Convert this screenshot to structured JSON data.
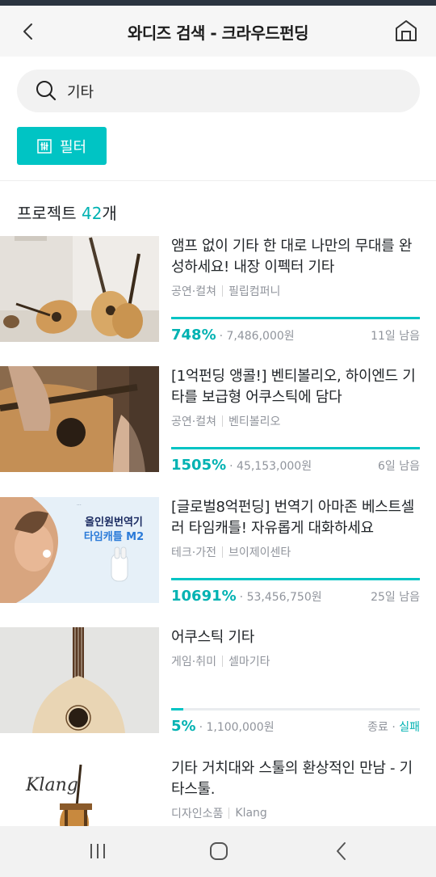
{
  "header": {
    "title": "와디즈 검색 - 크라우드펀딩"
  },
  "search": {
    "query": "기타"
  },
  "filter": {
    "label": "필터"
  },
  "results": {
    "prefix": "프로젝트 ",
    "count": "42",
    "suffix": "개"
  },
  "colors": {
    "accent": "#00c4c4",
    "accent_text": "#00b2b2",
    "meta_text": "#90949c",
    "header_bg": "#f6f6f6"
  },
  "projects": [
    {
      "title": "앰프 없이 기타 한 대로 나만의 무대를 완성하세요! 내장 이펙터 기타",
      "category": "공연·컬쳐",
      "maker": "필립컴퍼니",
      "percent": "748%",
      "amount": "· 7,486,000원",
      "remaining": "11일 남음",
      "progress": 1.0,
      "image": "acoustic-guitars-photo"
    },
    {
      "title": "[1억펀딩 앵콜!] 벤티볼리오, 하이엔드 기타를 보급형 어쿠스틱에 담다",
      "category": "공연·컬쳐",
      "maker": "벤티볼리오",
      "percent": "1505%",
      "amount": "· 45,153,000원",
      "remaining": "6일 남음",
      "progress": 1.0,
      "image": "guitar-playing-photo"
    },
    {
      "title": "[글로벌8억펀딩] 번역기 아마존 베스트셀러 타임캐틀! 자유롭게 대화하세요",
      "category": "테크·가전",
      "maker": "브이제이센타",
      "percent": "10691%",
      "amount": "· 53,456,750원",
      "remaining": "25일 남음",
      "progress": 1.0,
      "image": "translator-earbuds-photo",
      "banner_line1": "올인원번역기",
      "banner_line2": "타임캐틀 M2"
    },
    {
      "title": "어쿠스틱 기타",
      "category": "게임·취미",
      "maker": "셀마기타",
      "percent": "5%",
      "amount": "· 1,100,000원",
      "remaining_prefix": "종료 · ",
      "remaining_status": "실패",
      "progress": 0.05,
      "image": "wooden-mandolin-photo"
    },
    {
      "title": "기타 거치대와 스툴의 환상적인 만남 - 기타스툴.",
      "category": "디자인소품",
      "maker": "Klang",
      "image": "guitar-stool-photo",
      "logo_text": "Klang"
    }
  ],
  "navbar": {
    "icons": [
      "recent-apps-icon",
      "home-circle-icon",
      "back-icon"
    ]
  }
}
